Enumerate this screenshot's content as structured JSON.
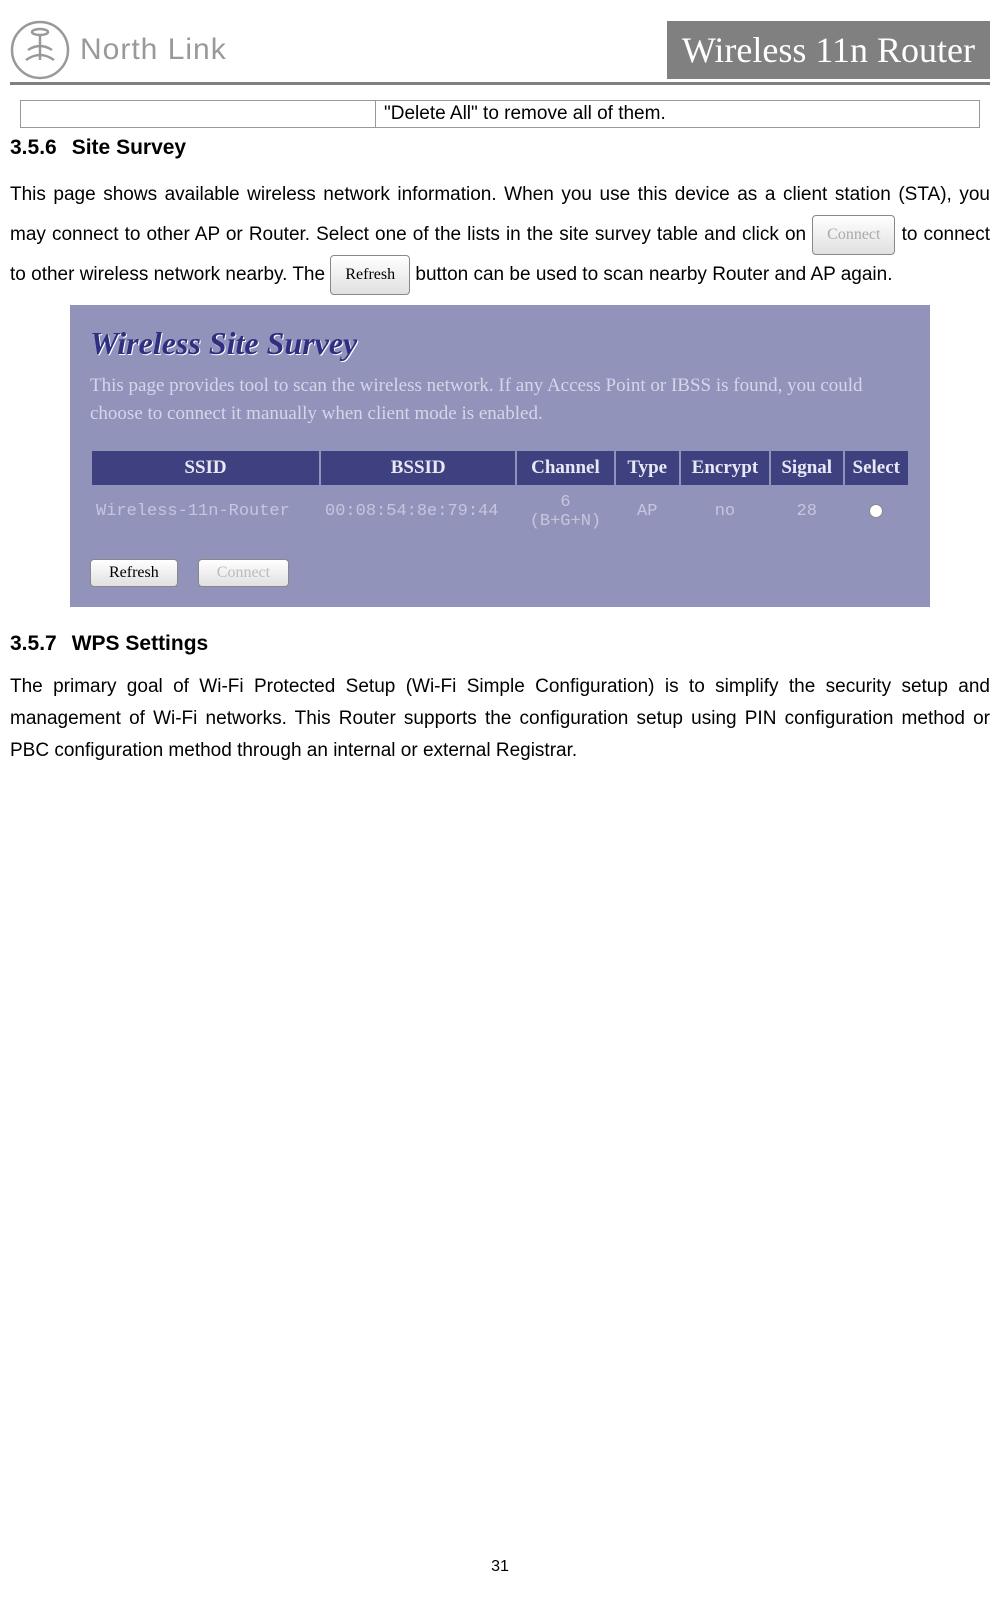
{
  "header": {
    "logo_text": "North Link",
    "title": "Wireless 11n Router"
  },
  "table_snippet": {
    "text": "\"Delete All\" to remove all of them."
  },
  "section1": {
    "number": "3.5.6",
    "heading": "Site Survey",
    "para_part1": "This page shows available wireless network information. When you use this device as a client station (STA), you may connect to other AP or Router. Select one of the lists in the site survey table and click on ",
    "btn_connect": "Connect",
    "para_part2": " to connect to other wireless network nearby. The ",
    "btn_refresh": "Refresh",
    "para_part3": " button can be used to scan nearby Router and AP again."
  },
  "screenshot": {
    "title": "Wireless Site Survey",
    "description": "This page provides tool to scan the wireless network. If any Access Point or IBSS is found, you could choose to connect it manually when client mode is enabled.",
    "headers": [
      "SSID",
      "BSSID",
      "Channel",
      "Type",
      "Encrypt",
      "Signal",
      "Select"
    ],
    "row": {
      "ssid": "Wireless-11n-Router",
      "bssid": "00:08:54:8e:79:44",
      "channel": "6\n(B+G+N)",
      "channel_line1": "6",
      "channel_line2": "(B+G+N)",
      "type": "AP",
      "encrypt": "no",
      "signal": "28"
    },
    "buttons": {
      "refresh": "Refresh",
      "connect": "Connect"
    }
  },
  "section2": {
    "number": "3.5.7",
    "heading": "WPS Settings",
    "para": "The primary goal of Wi-Fi Protected Setup (Wi-Fi Simple Configuration) is to simplify the security setup and management of Wi-Fi networks. This Router supports the configuration setup using PIN configuration method or PBC configuration method through an internal or external Registrar."
  },
  "page_number": "31"
}
